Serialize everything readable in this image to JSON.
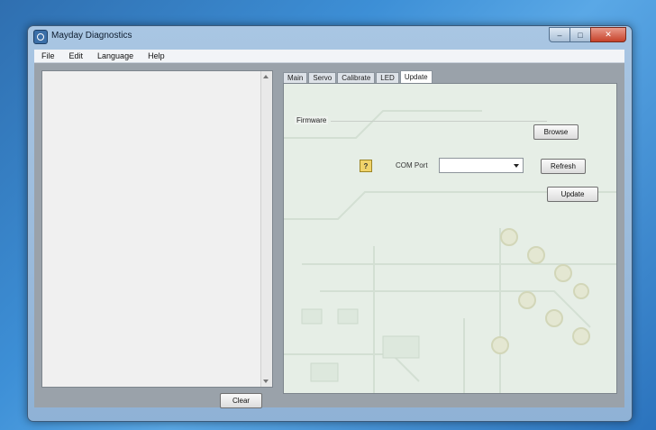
{
  "window": {
    "title": "Mayday Diagnostics",
    "controls": {
      "minimize": "–",
      "maximize": "□",
      "close": "✕"
    }
  },
  "menu": [
    "File",
    "Edit",
    "Language",
    "Help"
  ],
  "left_panel": {
    "clear_label": "Clear"
  },
  "tabs": [
    {
      "label": "Main",
      "active": false
    },
    {
      "label": "Servo",
      "active": false
    },
    {
      "label": "Calibrate",
      "active": false
    },
    {
      "label": "LED",
      "active": false
    },
    {
      "label": "Update",
      "active": true
    }
  ],
  "update_tab": {
    "firmware_label": "Firmware",
    "browse_label": "Browse",
    "help_glyph": "?",
    "com_port_label": "COM Port",
    "com_port_value": "",
    "refresh_label": "Refresh",
    "update_label": "Update"
  },
  "icons": {
    "app": "app-icon",
    "help": "help-icon",
    "dropdown": "chevron-down-icon"
  },
  "colors": {
    "desktop": "#3d8fd6",
    "window_frame": "#a9c6e3",
    "close_button": "#c6422a",
    "pcb_tint": "#e8efe8"
  }
}
